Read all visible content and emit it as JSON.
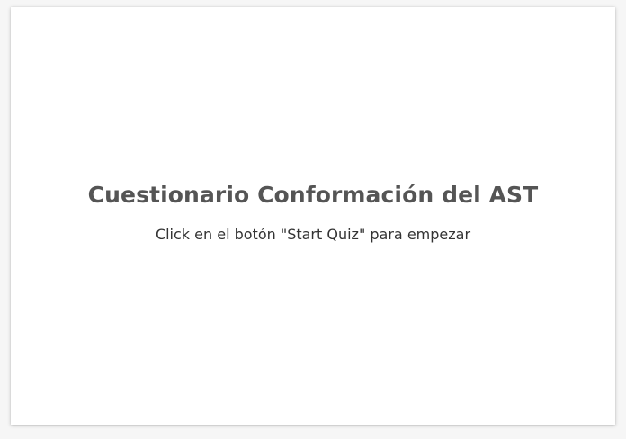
{
  "quiz": {
    "title": "Cuestionario Conformación del AST",
    "instruction": "Click en el botón \"Start Quiz\" para empezar"
  },
  "colors": {
    "page_background": "#f6f6f6",
    "card_background": "#ffffff",
    "title_text": "#555555",
    "body_text": "#333333"
  }
}
